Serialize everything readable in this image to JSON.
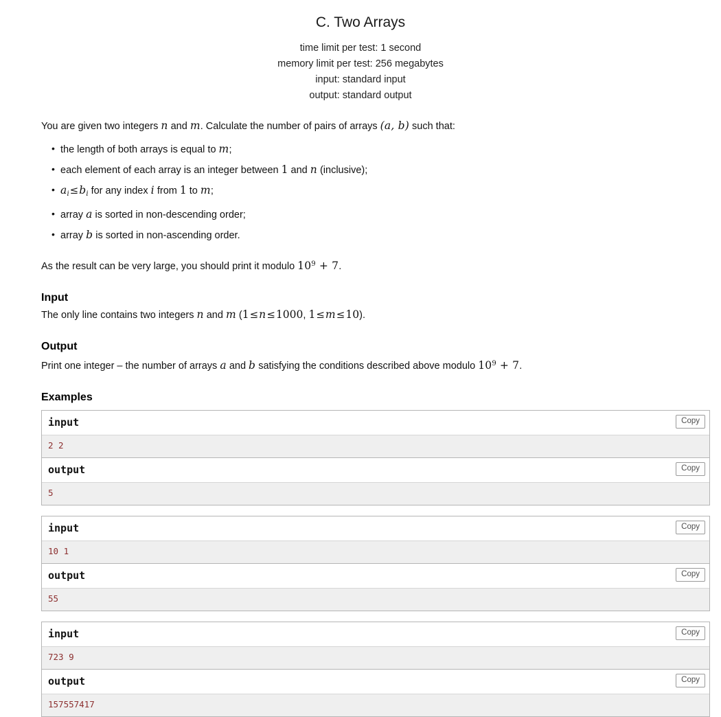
{
  "problem": {
    "title": "C. Two Arrays",
    "limits": [
      "time limit per test: 1 second",
      "memory limit per test: 256 megabytes",
      "input: standard input",
      "output: standard output"
    ],
    "statement": {
      "intro_1": "You are given two integers ",
      "intro_n": "n",
      "intro_2": " and ",
      "intro_m": "m",
      "intro_3": ". Calculate the number of pairs of arrays ",
      "intro_pair": "(a, b)",
      "intro_4": " such that:",
      "conditions": [
        {
          "part_1": "the length of both arrays is equal to ",
          "var_1": "m",
          "part_2": ";"
        },
        {
          "part_1": "each element of each array is an integer between ",
          "var_1": "1",
          "part_2": " and ",
          "var_2": "n",
          "part_3": " (inclusive);"
        },
        {
          "expr_a": "a",
          "expr_a_sub": "i",
          "expr_rel": "≤",
          "expr_b": "b",
          "expr_b_sub": "i",
          "part_1": " for any index ",
          "var_i": "i",
          "part_2": " from ",
          "var_1": "1",
          "part_3": " to ",
          "var_m": "m",
          "part_4": ";"
        },
        {
          "part_1": "array ",
          "var_a": "a",
          "part_2": " is sorted in non-descending order;"
        },
        {
          "part_1": "array ",
          "var_b": "b",
          "part_2": " is sorted in non-ascending order."
        }
      ],
      "modulo_line": {
        "part_1": "As the result can be very large, you should print it modulo ",
        "mod_base": "10",
        "mod_exp": "9",
        "mod_plus": "+ 7",
        "part_2": "."
      }
    },
    "input_section": {
      "heading": "Input",
      "part_1": "The only line contains two integers ",
      "var_n": "n",
      "part_2": " and ",
      "var_m": "m",
      "part_3": " (",
      "c1_lo": "1",
      "c1_rel1": "≤",
      "c1_var": "n",
      "c1_rel2": "≤",
      "c1_hi": "1000",
      "part_4": ", ",
      "c2_lo": "1",
      "c2_rel1": "≤",
      "c2_var": "m",
      "c2_rel2": "≤",
      "c2_hi": "10",
      "part_5": ")."
    },
    "output_section": {
      "heading": "Output",
      "part_1": "Print one integer – the number of arrays ",
      "var_a": "a",
      "part_2": " and ",
      "var_b": "b",
      "part_3": " satisfying the conditions described above modulo ",
      "mod_base": "10",
      "mod_exp": "9",
      "mod_plus": "+ 7",
      "part_4": "."
    },
    "examples_heading": "Examples",
    "copy_label": "Copy",
    "input_label": "input",
    "output_label": "output",
    "tests": [
      {
        "input": "2 2",
        "output": "5"
      },
      {
        "input": "10 1",
        "output": "55"
      },
      {
        "input": "723 9",
        "output": "157557417"
      }
    ]
  },
  "colors": {
    "sample_data_text": "#8c2f2f",
    "sample_data_bg": "#efefef",
    "border": "#b5b5b5"
  }
}
